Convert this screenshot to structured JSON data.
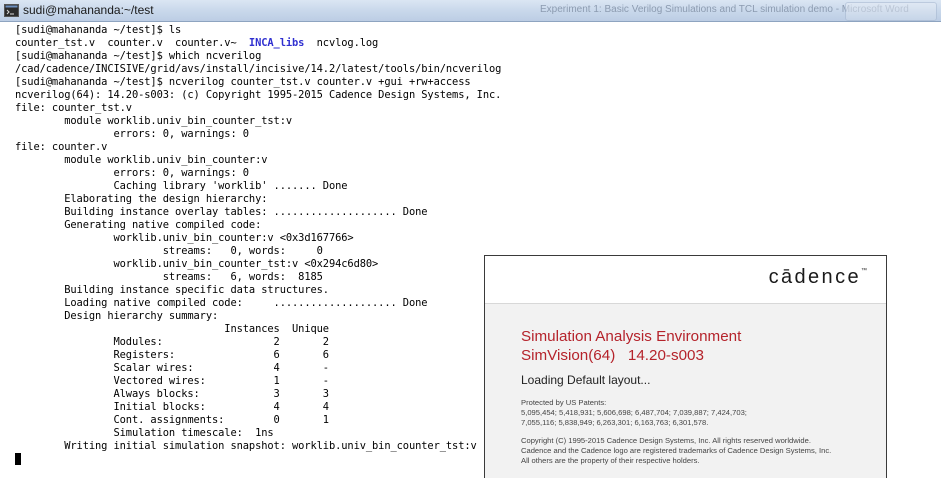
{
  "window": {
    "title": "sudi@mahananda:~/test",
    "background_title": "Experiment 1: Basic Verilog Simulations and TCL simulation demo - Microsoft Word",
    "colors": {
      "dir_listing": "#3030d0",
      "splash_product": "#b5232b"
    }
  },
  "terminal": {
    "lines": [
      "[sudi@mahananda ~/test]$ ls",
      "counter_tst.v  counter.v  counter.v~  ",
      "[sudi@mahananda ~/test]$ which ncverilog",
      "/cad/cadence/INCISIVE/grid/avs/install/incisive/14.2/latest/tools/bin/ncverilog",
      "[sudi@mahananda ~/test]$ ncverilog counter_tst.v counter.v +gui +rw+access",
      "ncverilog(64): 14.20-s003: (c) Copyright 1995-2015 Cadence Design Systems, Inc.",
      "file: counter_tst.v",
      "        module worklib.univ_bin_counter_tst:v",
      "                errors: 0, warnings: 0",
      "file: counter.v",
      "        module worklib.univ_bin_counter:v",
      "                errors: 0, warnings: 0",
      "                Caching library 'worklib' ....... Done",
      "        Elaborating the design hierarchy:",
      "        Building instance overlay tables: .................... Done",
      "        Generating native compiled code:",
      "                worklib.univ_bin_counter:v <0x3d167766>",
      "                        streams:   0, words:     0",
      "                worklib.univ_bin_counter_tst:v <0x294c6d80>",
      "                        streams:   6, words:  8185",
      "        Building instance specific data structures.",
      "        Loading native compiled code:     .................... Done",
      "        Design hierarchy summary:",
      "                                  Instances  Unique",
      "                Modules:                  2       2",
      "                Registers:                6       6",
      "                Scalar wires:             4       -",
      "                Vectored wires:           1       -",
      "                Always blocks:            3       3",
      "                Initial blocks:           4       4",
      "                Cont. assignments:        0       1",
      "                Simulation timescale:  1ns",
      "        Writing initial simulation snapshot: worklib.univ_bin_counter_tst:v"
    ],
    "ls_dir": "INCA_libs",
    "ls_tail": "  ncvlog.log"
  },
  "splash": {
    "logo": "cādence",
    "logo_tm": "™",
    "product_line1": "Simulation Analysis Environment",
    "product_line2": "SimVision(64)   14.20-s003",
    "status": "Loading Default layout...",
    "patents_heading": "Protected by US Patents:",
    "patents_line1": "5,095,454; 5,418,931; 5,606,698; 6,487,704; 7,039,887; 7,424,703;",
    "patents_line2": "7,055,116; 5,838,949; 6,263,301; 6,163,763; 6,301,578.",
    "copyright_line1": "Copyright (C) 1995-2015 Cadence Design Systems, Inc. All rights reserved worldwide.",
    "copyright_line2": "Cadence and the Cadence logo are registered trademarks of Cadence Design Systems, Inc.",
    "copyright_line3": "All others are the property of their respective holders."
  }
}
